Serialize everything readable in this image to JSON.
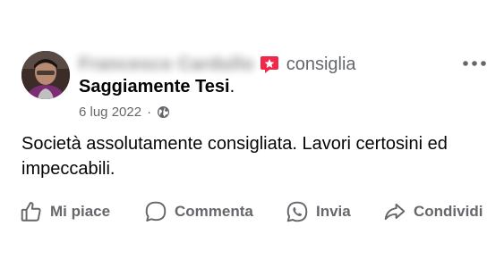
{
  "post": {
    "author_name": "Francesco Cardullo",
    "recommend_word": "consiglia",
    "page_name": "Saggiamente Tesi",
    "page_name_suffix": ".",
    "date": "6 lug 2022",
    "meta_separator": "·",
    "audience_icon": "globe-icon",
    "text": "Società assolutamente consigliata. Lavori certosini ed impeccabili.",
    "recommend_badge_color": "#f02849"
  },
  "actions": {
    "like_label": "Mi piace",
    "comment_label": "Commenta",
    "send_label": "Invia",
    "share_label": "Condividi"
  },
  "colors": {
    "secondary_text": "#65676b",
    "primary_text": "#050505"
  }
}
